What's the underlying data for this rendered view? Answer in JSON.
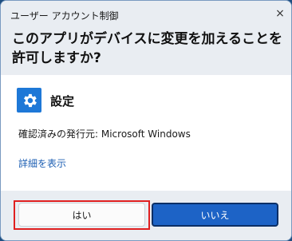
{
  "dialog": {
    "title": "ユーザー アカウント制御",
    "close_icon": "×",
    "question": "このアプリがデバイスに変更を加えることを許可しますか?"
  },
  "app": {
    "icon": "gear-icon",
    "name": "設定",
    "publisher": "確認済みの発行元: Microsoft Windows",
    "details_link": "詳細を表示"
  },
  "buttons": {
    "yes": "はい",
    "no": "いいえ"
  },
  "colors": {
    "accent": "#1d63c6",
    "highlight": "#e02020"
  }
}
